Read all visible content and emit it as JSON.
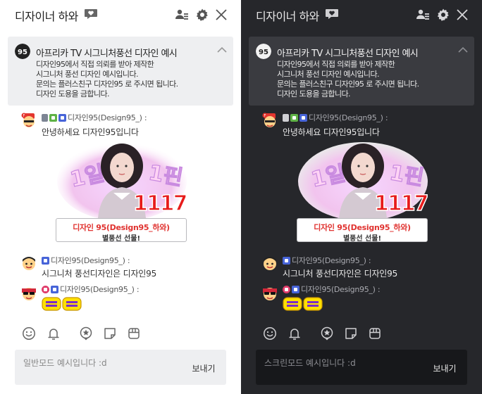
{
  "panels": [
    {
      "theme": "light",
      "title": "디자이너 하와",
      "notice": {
        "title": "아프리카 TV 시그니처풍선 디자인 예시",
        "lines": [
          "디자인95에서 직접 의뢰를 받아 제작한",
          "시그니처 풍선 디자인 예시입니다.",
          "문의는 플러스친구 디자인95 로 주시면 됩니다.",
          "디자인 도용을 금합니다."
        ]
      },
      "messages": [
        {
          "nick": "디자인95(Design95_) :",
          "text": "안녕하세요 디자인95입니다"
        },
        {
          "nick": "디자인95(Design95_) :",
          "text": "시그니처 풍선디자인은 디자인95"
        },
        {
          "nick": "디자인95(Design95_) :",
          "text": ""
        }
      ],
      "balloon": {
        "count": "1117",
        "name": "디자인 95(Design95_하와)",
        "gift_text": "별풍선 선물!"
      },
      "composer": {
        "placeholder": "일반모드 예시입니다 :d",
        "send_label": "보내기"
      }
    },
    {
      "theme": "dark",
      "title": "디자이너 하와",
      "notice": {
        "title": "아프리카 TV 시그니처풍선 디자인 예시",
        "lines": [
          "디자인95에서 직접 의뢰를 받아 제작한",
          "시그니처 풍선 디자인 예시입니다.",
          "문의는 플러스친구 디자인95 로 주시면 됩니다.",
          "디자인 도용을 금합니다."
        ]
      },
      "messages": [
        {
          "nick": "디자인95(Design95_) :",
          "text": "안녕하세요 디자인95입니다"
        },
        {
          "nick": "디자인95(Design95_) :",
          "text": "시그니처 풍선디자인은 디자인95"
        },
        {
          "nick": "디자인95(Design95_) :",
          "text": ""
        }
      ],
      "balloon": {
        "count": "1117",
        "name": "디자인 95(Design95_하와)",
        "gift_text": "별풍선 선물!"
      },
      "composer": {
        "placeholder": "스크린모드 예시입니다 :d",
        "send_label": "보내기"
      }
    }
  ],
  "colors": {
    "light_bg": "#ffffff",
    "dark_bg": "#26272b",
    "balloon_name": "#e0322f",
    "count_red": "#e71b1b",
    "badge_fan": "#5fb246",
    "badge_sub": "#4764d8",
    "badge_vip": "#e03b6a"
  },
  "icons": [
    "chat-bubble-heart-icon",
    "profile-list-icon",
    "gear-icon",
    "close-icon",
    "chevron-up-icon",
    "smile-icon",
    "bell-icon",
    "star-badge-icon",
    "sticker-icon",
    "gift-box-icon"
  ]
}
